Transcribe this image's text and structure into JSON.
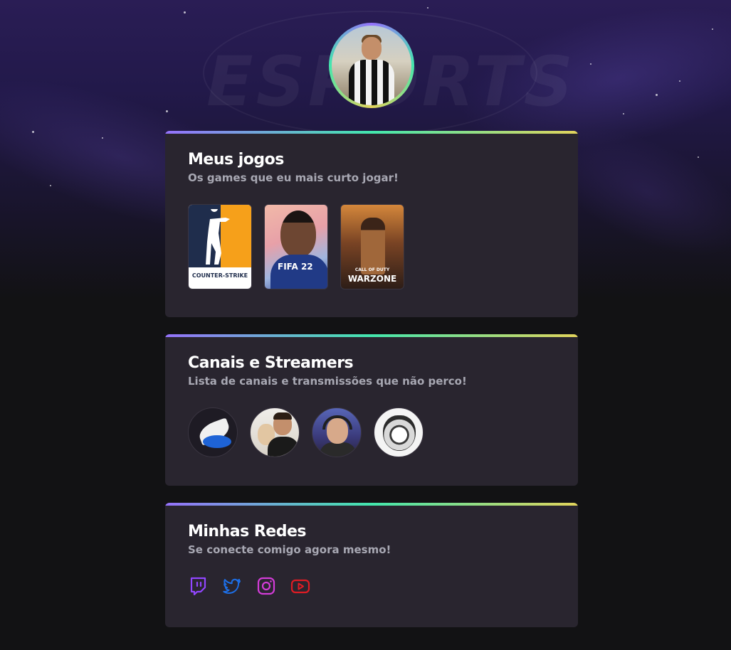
{
  "header": {
    "background_watermark": "ESPORTS",
    "avatar_alt": "Foto de perfil"
  },
  "colors": {
    "background": "#121214",
    "card": "#29252f",
    "gradient_start": "#9572fc",
    "gradient_mid": "#43e7ad",
    "gradient_end": "#e2d45c",
    "title": "#ffffff",
    "subtitle": "#a8a8b3",
    "twitch": "#9146ff",
    "twitter": "#1d6fe8",
    "instagram": "#d33cd8",
    "youtube": "#e01c24"
  },
  "games_section": {
    "title": "Meus jogos",
    "subtitle": "Os games que eu mais curto jogar!",
    "games": [
      {
        "name": "COUNTER-STRIKE",
        "id": "csgo"
      },
      {
        "name": "FIFA 22",
        "id": "fifa22"
      },
      {
        "name": "WARZONE",
        "top": "CALL OF DUTY",
        "id": "warzone"
      }
    ]
  },
  "streamers_section": {
    "title": "Canais e Streamers",
    "subtitle": "Lista de canais e transmissões que não perco!",
    "channels": [
      {
        "icon": "winged-helmet-logo"
      },
      {
        "icon": "streamer-with-mask"
      },
      {
        "icon": "streamer-with-headset"
      },
      {
        "icon": "tiger-logo"
      }
    ]
  },
  "social_section": {
    "title": "Minhas Redes",
    "subtitle": "Se conecte comigo agora mesmo!",
    "links": [
      {
        "icon": "twitch-icon"
      },
      {
        "icon": "twitter-icon"
      },
      {
        "icon": "instagram-icon"
      },
      {
        "icon": "youtube-icon"
      }
    ]
  }
}
